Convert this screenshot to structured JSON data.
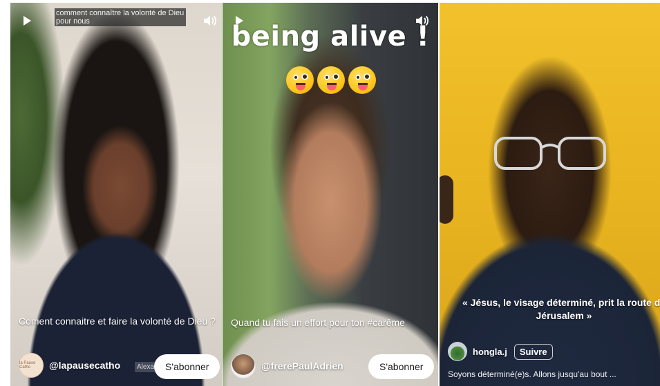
{
  "cards": [
    {
      "top_caption": "comment connaître la volonté de Dieu pour nous",
      "description": "Coment connaitre et faire la volonté de Dieu ?",
      "handle": "@lapausecatho",
      "faded_tag": "Alexa",
      "subscribe_label": "S'abonner",
      "avatar_text": "la Pause Catho"
    },
    {
      "overlay_title": "being alive !",
      "emoji_icons": [
        "zany-face-icon",
        "zany-face-icon",
        "zany-face-icon"
      ],
      "description": "Quand tu fais un effort pour ton #carême",
      "handle": "@frerePaulAdrien",
      "subscribe_label": "S'abonner"
    },
    {
      "quote": "« Jésus, le visage déterminé, prit la route de Jérusalem »",
      "handle": "hongla.j",
      "follow_label": "Suivre",
      "description": "Soyons déterminé(e)s. Allons jusqu'au bout ..."
    }
  ]
}
